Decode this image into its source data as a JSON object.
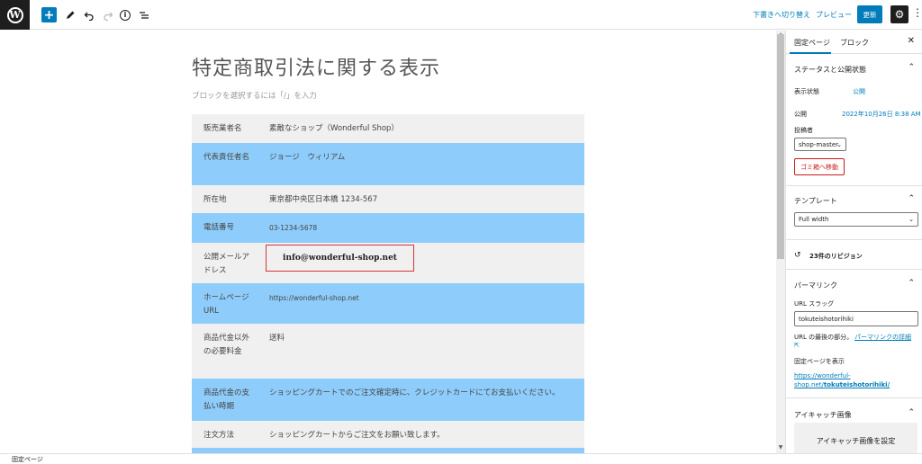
{
  "toolbar": {
    "logo_letter": "W",
    "add_glyph": "+",
    "draft_label": "下書きへ切り替え",
    "preview_label": "プレビュー",
    "update_label": "更新"
  },
  "editor": {
    "title": "特定商取引法に関する表示",
    "block_hint": "ブロックを選択するには「/」を入力",
    "rows": [
      {
        "label": "販売業者名",
        "value": "素敵なショップ（Wonderful Shop）"
      },
      {
        "label": "代表責任者名",
        "value": "ジョージ　ウィリアム"
      },
      {
        "label": "所在地",
        "value": "東京都中央区日本橋 1234-567"
      },
      {
        "label": "電話番号",
        "value": "03-1234-5678"
      },
      {
        "label": "公開メールアドレス",
        "value": "info@wonderful-shop.net"
      },
      {
        "label": "ホームページURL",
        "value": "https://wonderful-shop.net"
      },
      {
        "label": "商品代金以外の必要料金",
        "value": "送料"
      },
      {
        "label": "商品代金の支払い時期",
        "value": "ショッピングカートでのご注文確定時に、クレジットカードにてお支払いください。"
      },
      {
        "label": "注文方法",
        "value": "ショッピングカートからご注文をお願い致します。"
      }
    ]
  },
  "sidebar": {
    "tab_page": "固定ページ",
    "tab_block": "ブロック",
    "status_panel": {
      "title": "ステータスと公開状態",
      "visibility_label": "表示状態",
      "visibility_value": "公開",
      "publish_label": "公開",
      "publish_value": "2022年10月26日 8:38 AM",
      "author_label": "投稿者",
      "author_value": "shop-master",
      "trash_label": "ゴミ箱へ移動"
    },
    "template_panel": {
      "title": "テンプレート",
      "value": "Full width"
    },
    "revisions_label": "23件のリビジョン",
    "permalink_panel": {
      "title": "パーマリンク",
      "slug_label": "URL スラッグ",
      "slug_value": "tokuteishotorihiki",
      "slug_help_prefix": "URL の最後の部分。",
      "slug_help_link": "パーマリンクの詳細",
      "view_label": "固定ページを表示",
      "view_link_line1": "https://wonderful-",
      "view_link_line2_prefix": "shop.net/",
      "view_link_line2_bold": "tokuteishotorihiki/"
    },
    "featured_panel": {
      "title": "アイキャッチ画像",
      "button_label": "アイキャッチ画像を設定"
    }
  },
  "footer": {
    "breadcrumb": "固定ページ"
  }
}
